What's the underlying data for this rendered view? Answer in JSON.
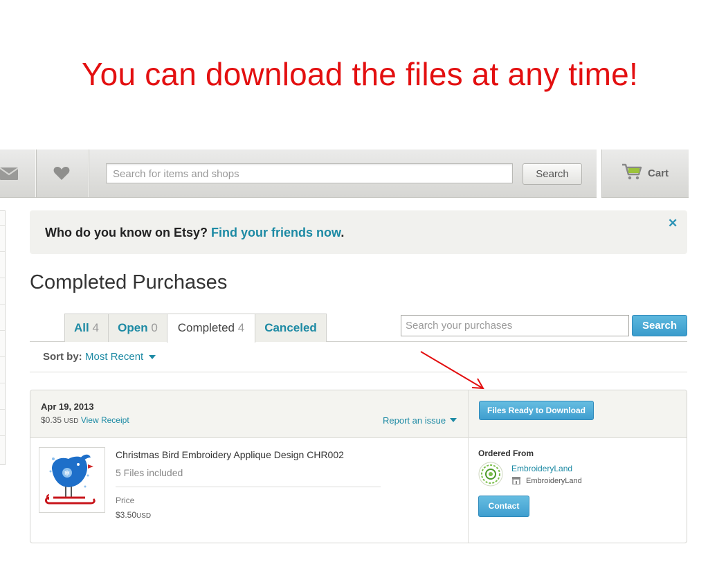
{
  "annotation": {
    "headline": "You can download the files at any time!",
    "arrow_color": "#e30f10"
  },
  "header": {
    "search_placeholder": "Search for items and shops",
    "search_button": "Search",
    "cart_label": "Cart",
    "icons": [
      "mail-icon",
      "heart-icon",
      "cart-icon"
    ]
  },
  "banner": {
    "question": "Who do you know on Etsy?",
    "link": "Find your friends now",
    "suffix": ".",
    "close_icon": "close-icon"
  },
  "page": {
    "title": "Completed Purchases"
  },
  "tabs": [
    {
      "label": "All",
      "count": "4",
      "active": false
    },
    {
      "label": "Open",
      "count": "0",
      "active": false
    },
    {
      "label": "Completed",
      "count": "4",
      "active": true
    },
    {
      "label": "Canceled",
      "count": "",
      "active": false
    }
  ],
  "purchase_search": {
    "placeholder": "Search your purchases",
    "button": "Search"
  },
  "sort": {
    "label": "Sort by:",
    "value": "Most Recent"
  },
  "order": {
    "date": "Apr 19, 2013",
    "total": "$0.35",
    "total_currency": "USD",
    "view_receipt": "View Receipt",
    "report_issue": "Report an issue",
    "download_button": "Files Ready to Download",
    "item": {
      "title": "Christmas Bird Embroidery Applique Design CHR002",
      "files": "5 Files included",
      "price_label": "Price",
      "price": "$3.50",
      "price_currency": "USD"
    },
    "seller": {
      "ordered_from_label": "Ordered From",
      "shop_link": "EmbroideryLand",
      "shop_name": "EmbroideryLand",
      "contact_button": "Contact"
    }
  },
  "colors": {
    "accent": "#1d8aa4",
    "button_blue": "#3f9ecf",
    "headline_red": "#e30f10"
  }
}
